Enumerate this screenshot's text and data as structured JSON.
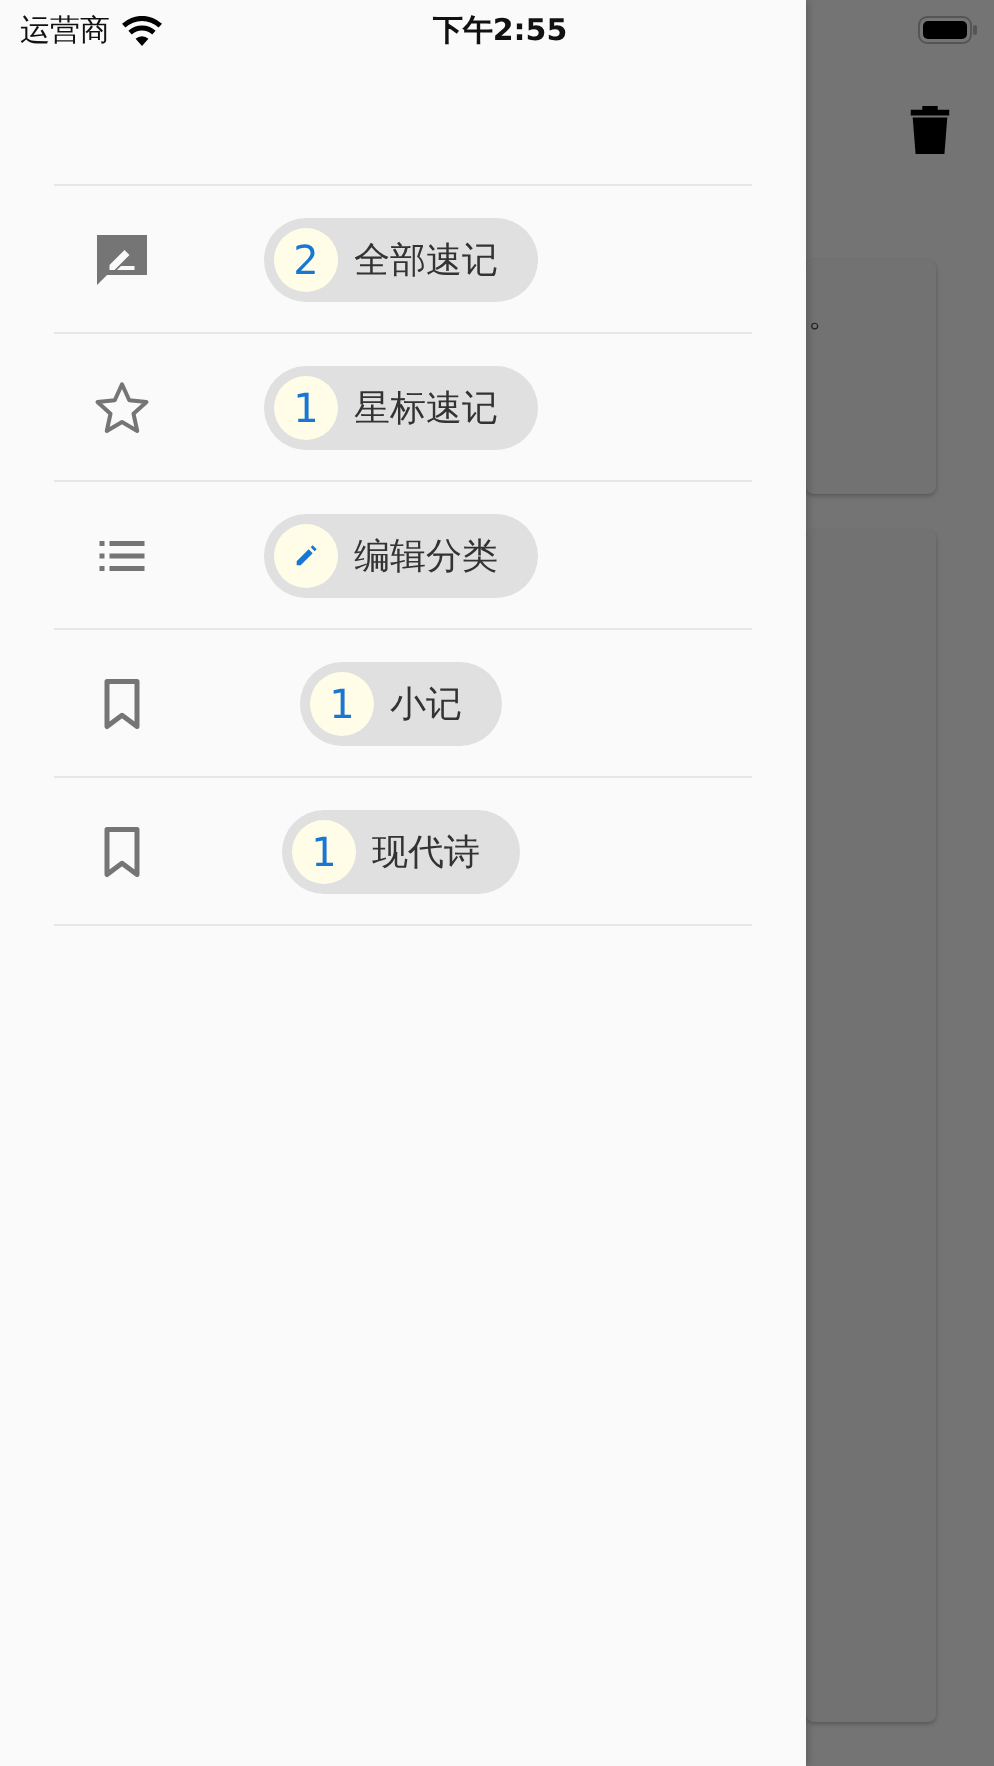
{
  "status_bar": {
    "carrier": "运营商",
    "time": "下午2:55"
  },
  "background": {
    "cards": [
      {
        "kind": "short",
        "text": "。"
      },
      {
        "kind": "tall"
      }
    ]
  },
  "drawer": {
    "items": [
      {
        "kind": "all",
        "count": "2",
        "label": "全部速记"
      },
      {
        "kind": "starred",
        "count": "1",
        "label": "星标速记"
      },
      {
        "kind": "edit",
        "label": "编辑分类"
      },
      {
        "kind": "category",
        "count": "1",
        "label": "小记"
      },
      {
        "kind": "category",
        "count": "1",
        "label": "现代诗"
      }
    ]
  }
}
